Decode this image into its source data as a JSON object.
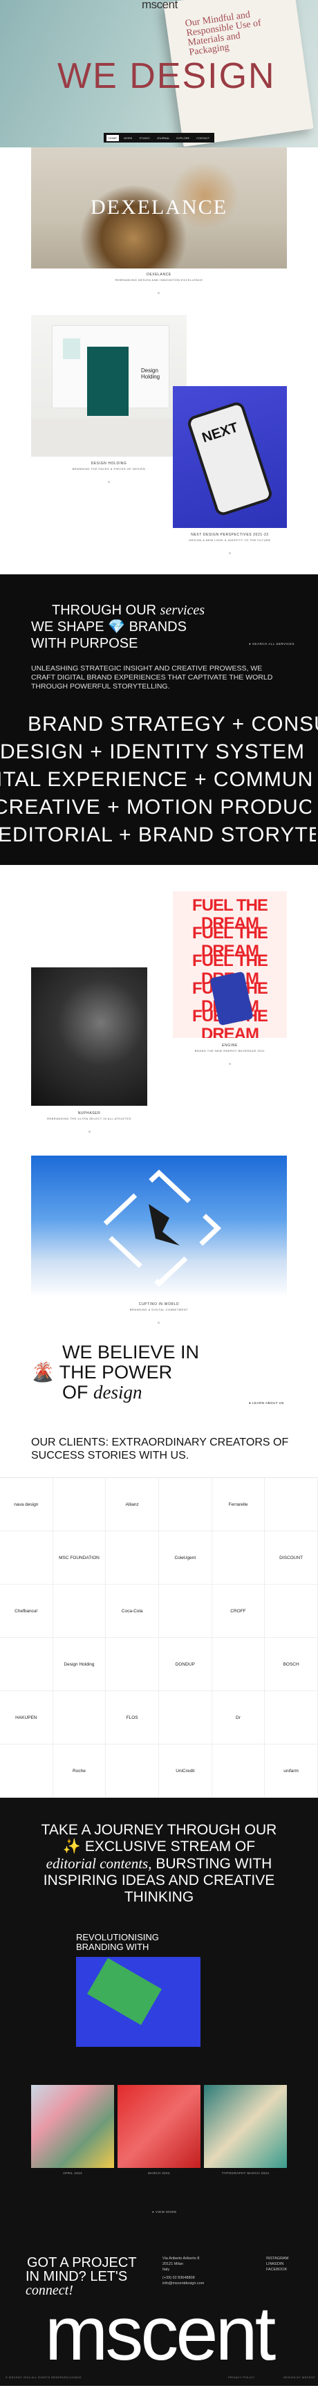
{
  "hero": {
    "logo": "mscent",
    "title": "WE DESIGN",
    "book_text": "Our Mindful and Responsible Use of Materials and Packaging",
    "nav": [
      "Home",
      "Work",
      "Studio",
      "Journal",
      "Explore",
      "Contact"
    ]
  },
  "projects": [
    {
      "logo": "DEXELANCE",
      "title": "DEXELANCE",
      "subtitle": "REBRANDING DESIGN AND INNOVATION EXCELLENCE"
    },
    {
      "label": "Design Holding",
      "title": "DESIGN HOLDING",
      "subtitle": "BRANDING THE FACES & PIECES OF DESIGN"
    },
    {
      "logo": "NEXT",
      "title": "NEXT DESIGN PERSPECTIVES 2021-22",
      "subtitle": "DESIGN A NEW LOOK & IDENTITY TO THE FUTURE"
    }
  ],
  "services": {
    "heading_1": "THROUGH OUR",
    "heading_1_italic": "services",
    "heading_2": "WE SHAPE 💎 BRANDS",
    "heading_3": "WITH PURPOSE",
    "cta": "SEARCH ALL SERVICES",
    "paragraph": "UNLEASHING STRATEGIC INSIGHT AND CREATIVE PROWESS, WE CRAFT DIGITAL BRAND EXPERIENCES THAT CAPTIVATE THE WORLD THROUGH POWERFUL STORYTELLING.",
    "marquee": [
      "BRAND STRATEGY + CONSULTING",
      "DESIGN + IDENTITY SYSTEM",
      "ITAL EXPERIENCE + COMMUNICATION",
      "CREATIVE + MOTION PRODUCTION",
      "EDITORIAL + BRAND STORYTELLING"
    ]
  },
  "gallery": [
    {
      "title": "NUPHASER",
      "subtitle": "REBRANDING THE ULTRA SELECT IN ALL ATHLETES"
    },
    {
      "title": "ENGINE",
      "subtitle": "BRAND THE NEW ENERGY BEVERAGE 2021",
      "fuel": "FUEL THE DREAM"
    },
    {
      "title": "CUPTINO IN WORLD",
      "subtitle": "BRANDING & DIGITAL COMMITMENT"
    }
  ],
  "believe": {
    "line_1": "WE BELIEVE IN",
    "line_2": "THE POWER",
    "line_3": "OF",
    "line_3_italic": "design",
    "cta": "LEARN ABOUT US",
    "clients_heading": "OUR CLIENTS: EXTRAORDINARY CREATORS OF SUCCESS STORIES WITH US."
  },
  "clients": [
    "nava design",
    "",
    "Allianz",
    "",
    "Ferrarelle",
    "",
    "",
    "MSC FOUNDATION",
    "",
    "ColeUgent",
    "",
    "DISCOUNT",
    "Chefbanca!",
    "",
    "Coca-Cola",
    "",
    "CROFF",
    "",
    "",
    "Design Holding",
    "",
    "DONDUP",
    "",
    "BOSCH",
    "HAKUPEN",
    "",
    "FLOS",
    "",
    "Dr",
    "",
    "",
    "Roche",
    "",
    "UniCredit",
    "",
    "unifarm"
  ],
  "journey": {
    "heading_1": "TAKE A JOURNEY THROUGH OUR",
    "heading_2": "✨ EXCLUSIVE STREAM OF",
    "heading_3_italic": "editorial contents,",
    "heading_3": "BURSTING WITH",
    "heading_4": "INSPIRING IDEAS AND CREATIVE",
    "heading_5": "THINKING",
    "featured_title": "REVOLUTIONISING BRANDING WITH",
    "thumbs": [
      "APRIL 2024",
      "MARCH 2024",
      "TYPOGRAPHY MARCH 2024"
    ],
    "more": "VIEW MORE"
  },
  "footer": {
    "heading_1": "GOT A PROJECT",
    "heading_2": "IN MIND? LET'S",
    "heading_3_italic": "connect!",
    "address": [
      "Via Ariberto Ariberto 8",
      "20121 Milan",
      "Italy"
    ],
    "phone": "(+39) 02 83648808",
    "email": "info@mscentdesign.com",
    "social": [
      "INSTAGRAM",
      "LINKEDIN",
      "FACEBOOK"
    ],
    "logo": "mscent",
    "bottom_left": "© MSCENT 2024 ALL RIGHTS RESERVED",
    "bottom_mid": "COOKIE",
    "bottom_right": "PRIVACY POLICY",
    "bottom_far": "DESIGN BY MSCENT"
  },
  "colors": {
    "accent": "#9a3c44",
    "dark": "#0d0d0d",
    "red": "#e8242a",
    "blue": "#2f3fe0"
  }
}
